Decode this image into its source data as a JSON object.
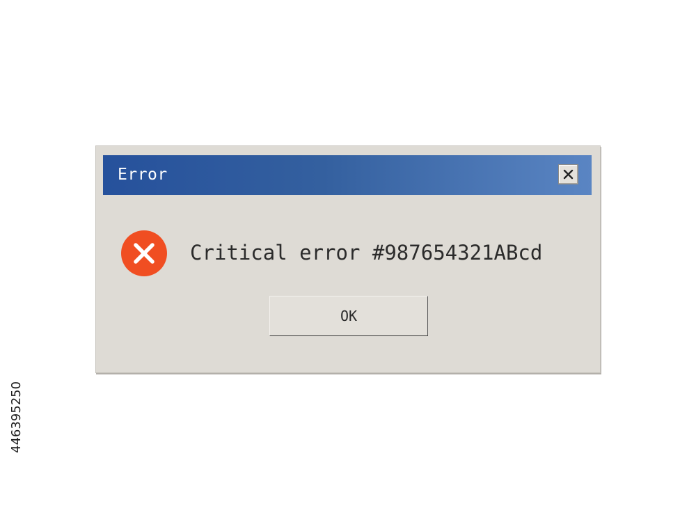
{
  "dialog": {
    "title": "Error",
    "message": "Critical error #987654321ABcd",
    "ok_label": "OK",
    "close_icon": "close-icon",
    "status_icon": "error-icon"
  },
  "watermark": {
    "side_id": "446395250"
  },
  "colors": {
    "titlebar_start": "#26519c",
    "titlebar_end": "#5a85c3",
    "dialog_bg": "#dedbd5",
    "error_red": "#f04e22"
  }
}
